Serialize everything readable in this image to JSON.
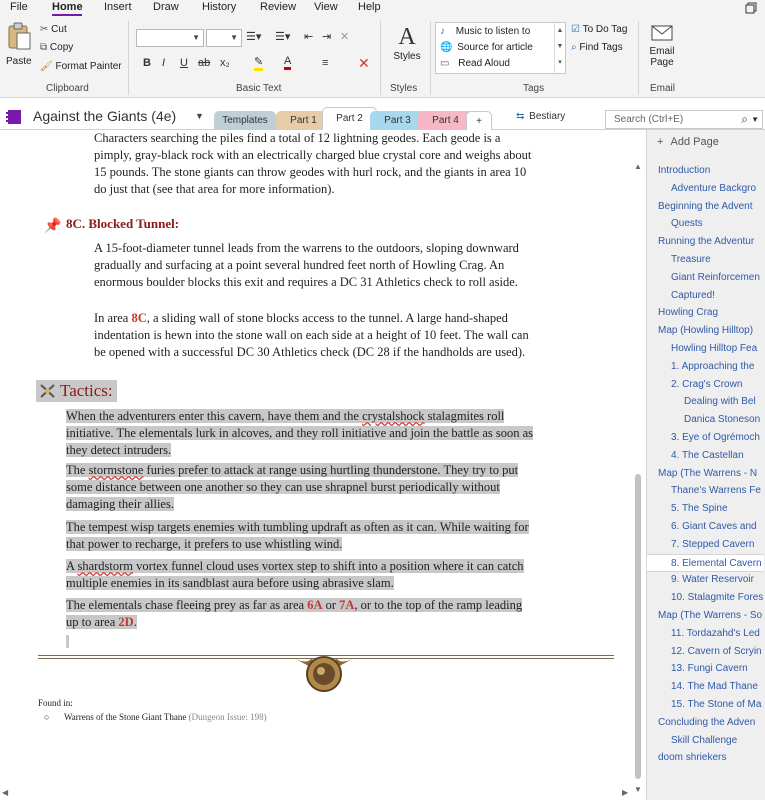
{
  "menu": {
    "items": [
      "File",
      "Home",
      "Insert",
      "Draw",
      "History",
      "Review",
      "View",
      "Help"
    ],
    "active": "Home"
  },
  "ribbon": {
    "clipboard": {
      "paste": "Paste",
      "cut": "Cut",
      "copy": "Copy",
      "format_painter": "Format Painter",
      "label": "Clipboard"
    },
    "basic_text": {
      "font_name": "",
      "font_size": "",
      "bold": "B",
      "italic": "I",
      "underline": "U",
      "strike": "ab",
      "subscript": "x₂",
      "label": "Basic Text"
    },
    "styles": {
      "button": "Styles",
      "label": "Styles"
    },
    "tags": {
      "items": [
        "Music to listen to",
        "Source for article",
        "Read Aloud"
      ],
      "todo": "To Do Tag",
      "find": "Find Tags",
      "label": "Tags"
    },
    "email": {
      "button_line1": "Email",
      "button_line2": "Page",
      "label": "Email"
    }
  },
  "notebook": {
    "title": "Against the Giants (4e)",
    "sections": [
      {
        "label": "Templates",
        "color": "#bfcfd8"
      },
      {
        "label": "Part 1",
        "color": "#e8cba8"
      },
      {
        "label": "Part 2",
        "color": "#d9d9d9"
      },
      {
        "label": "Part 3",
        "color": "#a8d8ee"
      },
      {
        "label": "Part 4",
        "color": "#f5b8c4"
      }
    ],
    "add_section": "+",
    "bestiary": "Bestiary",
    "search_placeholder": "Search (Ctrl+E)"
  },
  "page": {
    "p0": "Characters searching the piles find a total of 12 lightning geodes. Each geode is a pimply, gray-black rock with an electrically charged blue crystal core and weighs about 15 pounds. The stone giants can throw geodes with hurl rock, and the giants in area 10 do just that (see that area for more information).",
    "heading_8c": "8C. Blocked Tunnel:",
    "p1": "A 15-foot-diameter tunnel leads from the warrens to the outdoors, sloping downward gradually and surfacing at a point several hundred feet north of Howling Crag. An enormous boulder blocks this exit and requires a DC 31 Athletics check to roll aside.",
    "p2_a": "In area ",
    "p2_ref": "8C",
    "p2_b": ", a sliding wall of stone blocks access to the tunnel. A large hand-shaped indentation is hewn into the stone wall on each side at a height of 10 feet. The wall can be opened with a successful DC 30 Athletics check (DC 28 if the handholds are used).",
    "tactics_heading": "Tactics:",
    "t1_a": "When the adventurers enter this cavern, have them and the ",
    "t1_sq": "crystalshock",
    "t1_b": " stalagmites roll initiative. The elementals lurk in alcoves, and they roll initiative and join the battle as soon as they detect intruders.",
    "t2_a": "The ",
    "t2_sq": "stormstone",
    "t2_b": " furies prefer to attack at range using hurtling thunderstone. They try to put some distance between one another so they can use shrapnel burst periodically without damaging their allies.",
    "t3": "The tempest wisp targets enemies with tumbling updraft as often as it can. While waiting for that power to recharge, it prefers to use whistling wind.",
    "t4_a": "A ",
    "t4_sq": "shardstorm",
    "t4_b": " vortex funnel cloud uses vortex step to shift into a position where it can catch multiple enemies in its sandblast aura before using abrasive slam.",
    "t5_a": "The elementals chase fleeing prey as far as area ",
    "t5_r1": "6A",
    "t5_or": " or ",
    "t5_r2": "7A",
    "t5_b": ", or to the top of the ramp leading up to area ",
    "t5_r3": "2D",
    "t5_end": ".",
    "found_in": "Found in:",
    "found_source": "Warrens of the Stone Giant Thane",
    "found_issue": "(Dungeon Issue: 198)"
  },
  "pagelist": {
    "add_page": "Add Page",
    "items": [
      {
        "label": "Introduction",
        "indent": 0
      },
      {
        "label": "Adventure Backgro",
        "indent": 1
      },
      {
        "label": "Beginning the Advent",
        "indent": 0
      },
      {
        "label": "Quests",
        "indent": 1
      },
      {
        "label": "Running the Adventur",
        "indent": 0
      },
      {
        "label": "Treasure",
        "indent": 1
      },
      {
        "label": "Giant Reinforcemen",
        "indent": 1
      },
      {
        "label": "Captured!",
        "indent": 1
      },
      {
        "label": "Howling Crag",
        "indent": 0
      },
      {
        "label": "Map (Howling Hilltop)",
        "indent": 0
      },
      {
        "label": "Howling Hilltop Fea",
        "indent": 1
      },
      {
        "label": "1. Approaching the",
        "indent": 1
      },
      {
        "label": "2. Crag's Crown",
        "indent": 1
      },
      {
        "label": "Dealing with Bel",
        "indent": 2
      },
      {
        "label": "Danica Stoneson",
        "indent": 2
      },
      {
        "label": "3. Eye of Ogrémoch",
        "indent": 1
      },
      {
        "label": "4. The Castellan",
        "indent": 1
      },
      {
        "label": "Map (The Warrens - N",
        "indent": 0
      },
      {
        "label": "Thane's Warrens Fe",
        "indent": 1
      },
      {
        "label": "5. The Spine",
        "indent": 1
      },
      {
        "label": "6. Giant Caves and",
        "indent": 1
      },
      {
        "label": "7. Stepped Cavern",
        "indent": 1
      },
      {
        "label": "8. Elemental Cavern",
        "indent": 1,
        "selected": true
      },
      {
        "label": "9. Water Reservoir",
        "indent": 1
      },
      {
        "label": "10. Stalagmite Fores",
        "indent": 1
      },
      {
        "label": "Map (The Warrens - So",
        "indent": 0
      },
      {
        "label": "11. Tordazahd's Led",
        "indent": 1
      },
      {
        "label": "12. Cavern of Scryin",
        "indent": 1
      },
      {
        "label": "13. Fungi Cavern",
        "indent": 1
      },
      {
        "label": "14. The Mad Thane",
        "indent": 1
      },
      {
        "label": "15. The Stone of Ma",
        "indent": 1
      },
      {
        "label": "Concluding the Adven",
        "indent": 0
      },
      {
        "label": "Skill Challenge",
        "indent": 1
      },
      {
        "label": "doom shriekers",
        "indent": 0
      }
    ]
  },
  "colors": {
    "accent": "#7719aa",
    "ref_red": "#c0392b",
    "heading_red": "#8b1a1a",
    "highlight": "#c8c8c8",
    "pagelist_link": "#2f5aa8"
  }
}
